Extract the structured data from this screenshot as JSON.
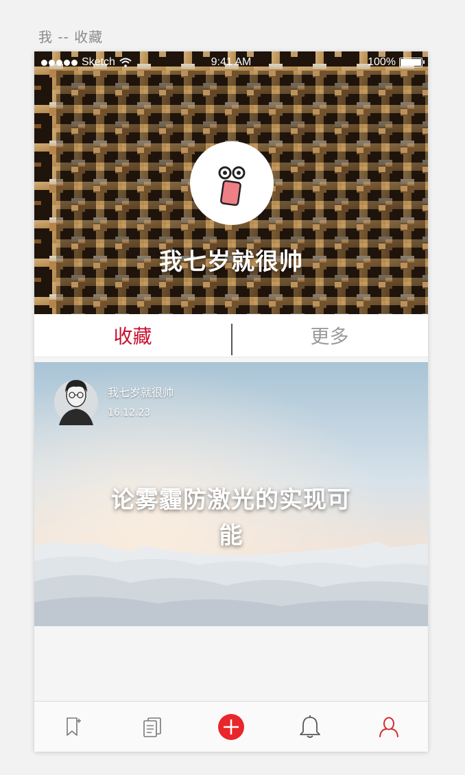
{
  "page": {
    "title": "我 -- 收藏"
  },
  "status_bar": {
    "carrier": "Sketch",
    "time": "9:41 AM",
    "battery": "100%"
  },
  "profile": {
    "username": "我七岁就很帅",
    "avatar_icon": "surprised-face-icon"
  },
  "tabs": [
    {
      "label": "收藏",
      "active": true
    },
    {
      "label": "更多",
      "active": false
    }
  ],
  "feed": [
    {
      "author": "我七岁就很帅",
      "date": "16.12.23",
      "title": "论雾霾防激光的实现可能"
    }
  ],
  "bottom_nav": [
    {
      "icon": "bookmark-add-icon"
    },
    {
      "icon": "documents-icon"
    },
    {
      "icon": "add-circle-icon"
    },
    {
      "icon": "bell-icon"
    },
    {
      "icon": "user-icon"
    }
  ],
  "colors": {
    "accent": "#c8102e",
    "add_button": "#e8262b",
    "inactive_text": "#9a9a9a"
  }
}
